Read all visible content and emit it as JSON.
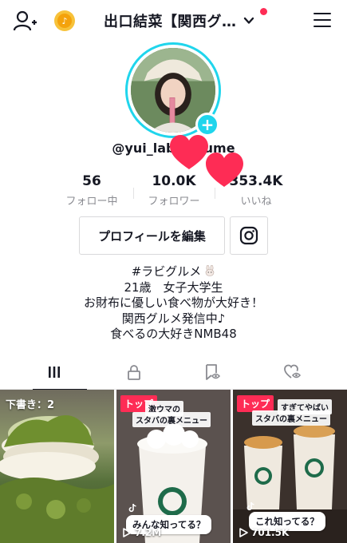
{
  "header": {
    "title": "出口結菜【関西グ…",
    "icons": {
      "add_user": "add-user-icon",
      "coin": "coin-icon",
      "chevron": "chevron-down-icon",
      "menu": "menu-icon"
    },
    "coin_glyph": "♪"
  },
  "profile": {
    "username": "@yui_labiqurume",
    "plus_label": "+"
  },
  "stats": [
    {
      "value": "56",
      "label": "フォロー中"
    },
    {
      "value": "10.0K",
      "label": "フォロワー"
    },
    {
      "value": "353.4K",
      "label": "いいね"
    }
  ],
  "actions": {
    "edit_profile": "プロフィールを編集",
    "instagram_icon": "instagram-icon"
  },
  "bio": {
    "lines": [
      "#ラビグルメ",
      "21歳　女子大学生",
      "お財布に優しい食べ物が大好き！",
      "関西グルメ発信中♪",
      "食べるの大好きNMB48"
    ]
  },
  "tabs": [
    {
      "name": "videos",
      "icon": "grid-bars-icon",
      "active": true
    },
    {
      "name": "private",
      "icon": "lock-icon",
      "active": false
    },
    {
      "name": "favorites",
      "icon": "bookmark-eye-icon",
      "active": false
    },
    {
      "name": "liked",
      "icon": "heart-eye-icon",
      "active": false
    }
  ],
  "videos": [
    {
      "draft_label": "下書き：2"
    },
    {
      "badge": "トップ",
      "caption_line1": "激ウマの",
      "caption_line2": "スタバの裏メニュー",
      "bottom_caption": "みんな知ってる？",
      "views": "7.2M"
    },
    {
      "badge": "トップ",
      "caption_line1": "すぎてやばい",
      "caption_line2": "スタバの裏メニュー",
      "bottom_caption": "これ知ってる？",
      "views": "701.5K"
    }
  ],
  "colors": {
    "accent_cyan": "#20d5ec",
    "badge_red": "#fe2c55",
    "heart_pink": "#fe2c55",
    "coin_yellow": "#f7c23a"
  }
}
